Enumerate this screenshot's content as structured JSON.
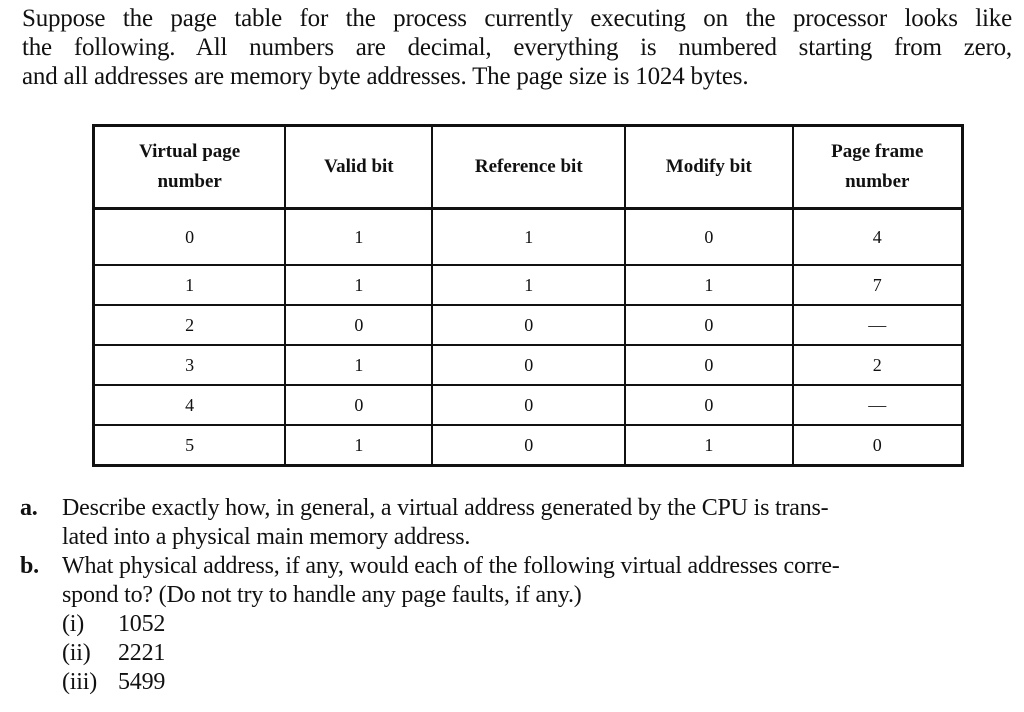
{
  "intro": {
    "lines": [
      "Suppose the page table for the process currently executing on the processor looks like",
      "the following. All numbers are decimal, everything is numbered starting from zero,",
      "and all addresses are memory byte addresses. The page size is 1024 bytes."
    ]
  },
  "table": {
    "headers": [
      {
        "top": "Virtual page",
        "bottom": "number"
      },
      {
        "top": "",
        "bottom": "Valid bit"
      },
      {
        "top": "",
        "bottom": "Reference bit"
      },
      {
        "top": "",
        "bottom": "Modify bit"
      },
      {
        "top": "Page frame",
        "bottom": "number"
      }
    ],
    "rows": [
      [
        "0",
        "1",
        "1",
        "0",
        "4"
      ],
      [
        "1",
        "1",
        "1",
        "1",
        "7"
      ],
      [
        "2",
        "0",
        "0",
        "0",
        "—"
      ],
      [
        "3",
        "1",
        "0",
        "0",
        "2"
      ],
      [
        "4",
        "0",
        "0",
        "0",
        "—"
      ],
      [
        "5",
        "1",
        "0",
        "1",
        "0"
      ]
    ]
  },
  "questions": [
    {
      "label": "a.",
      "lines": [
        "Describe exactly how, in general, a virtual address generated by the CPU is trans-",
        "lated into a physical main memory address."
      ]
    },
    {
      "label": "b.",
      "lines": [
        "What physical address, if any, would each of the following virtual addresses corre-",
        "spond to? (Do not try to handle any page faults, if any.)"
      ]
    }
  ],
  "subitems": [
    {
      "label": "(i)",
      "value": "1052"
    },
    {
      "label": "(ii)",
      "value": "2221"
    },
    {
      "label": "(iii)",
      "value": "5499"
    }
  ]
}
